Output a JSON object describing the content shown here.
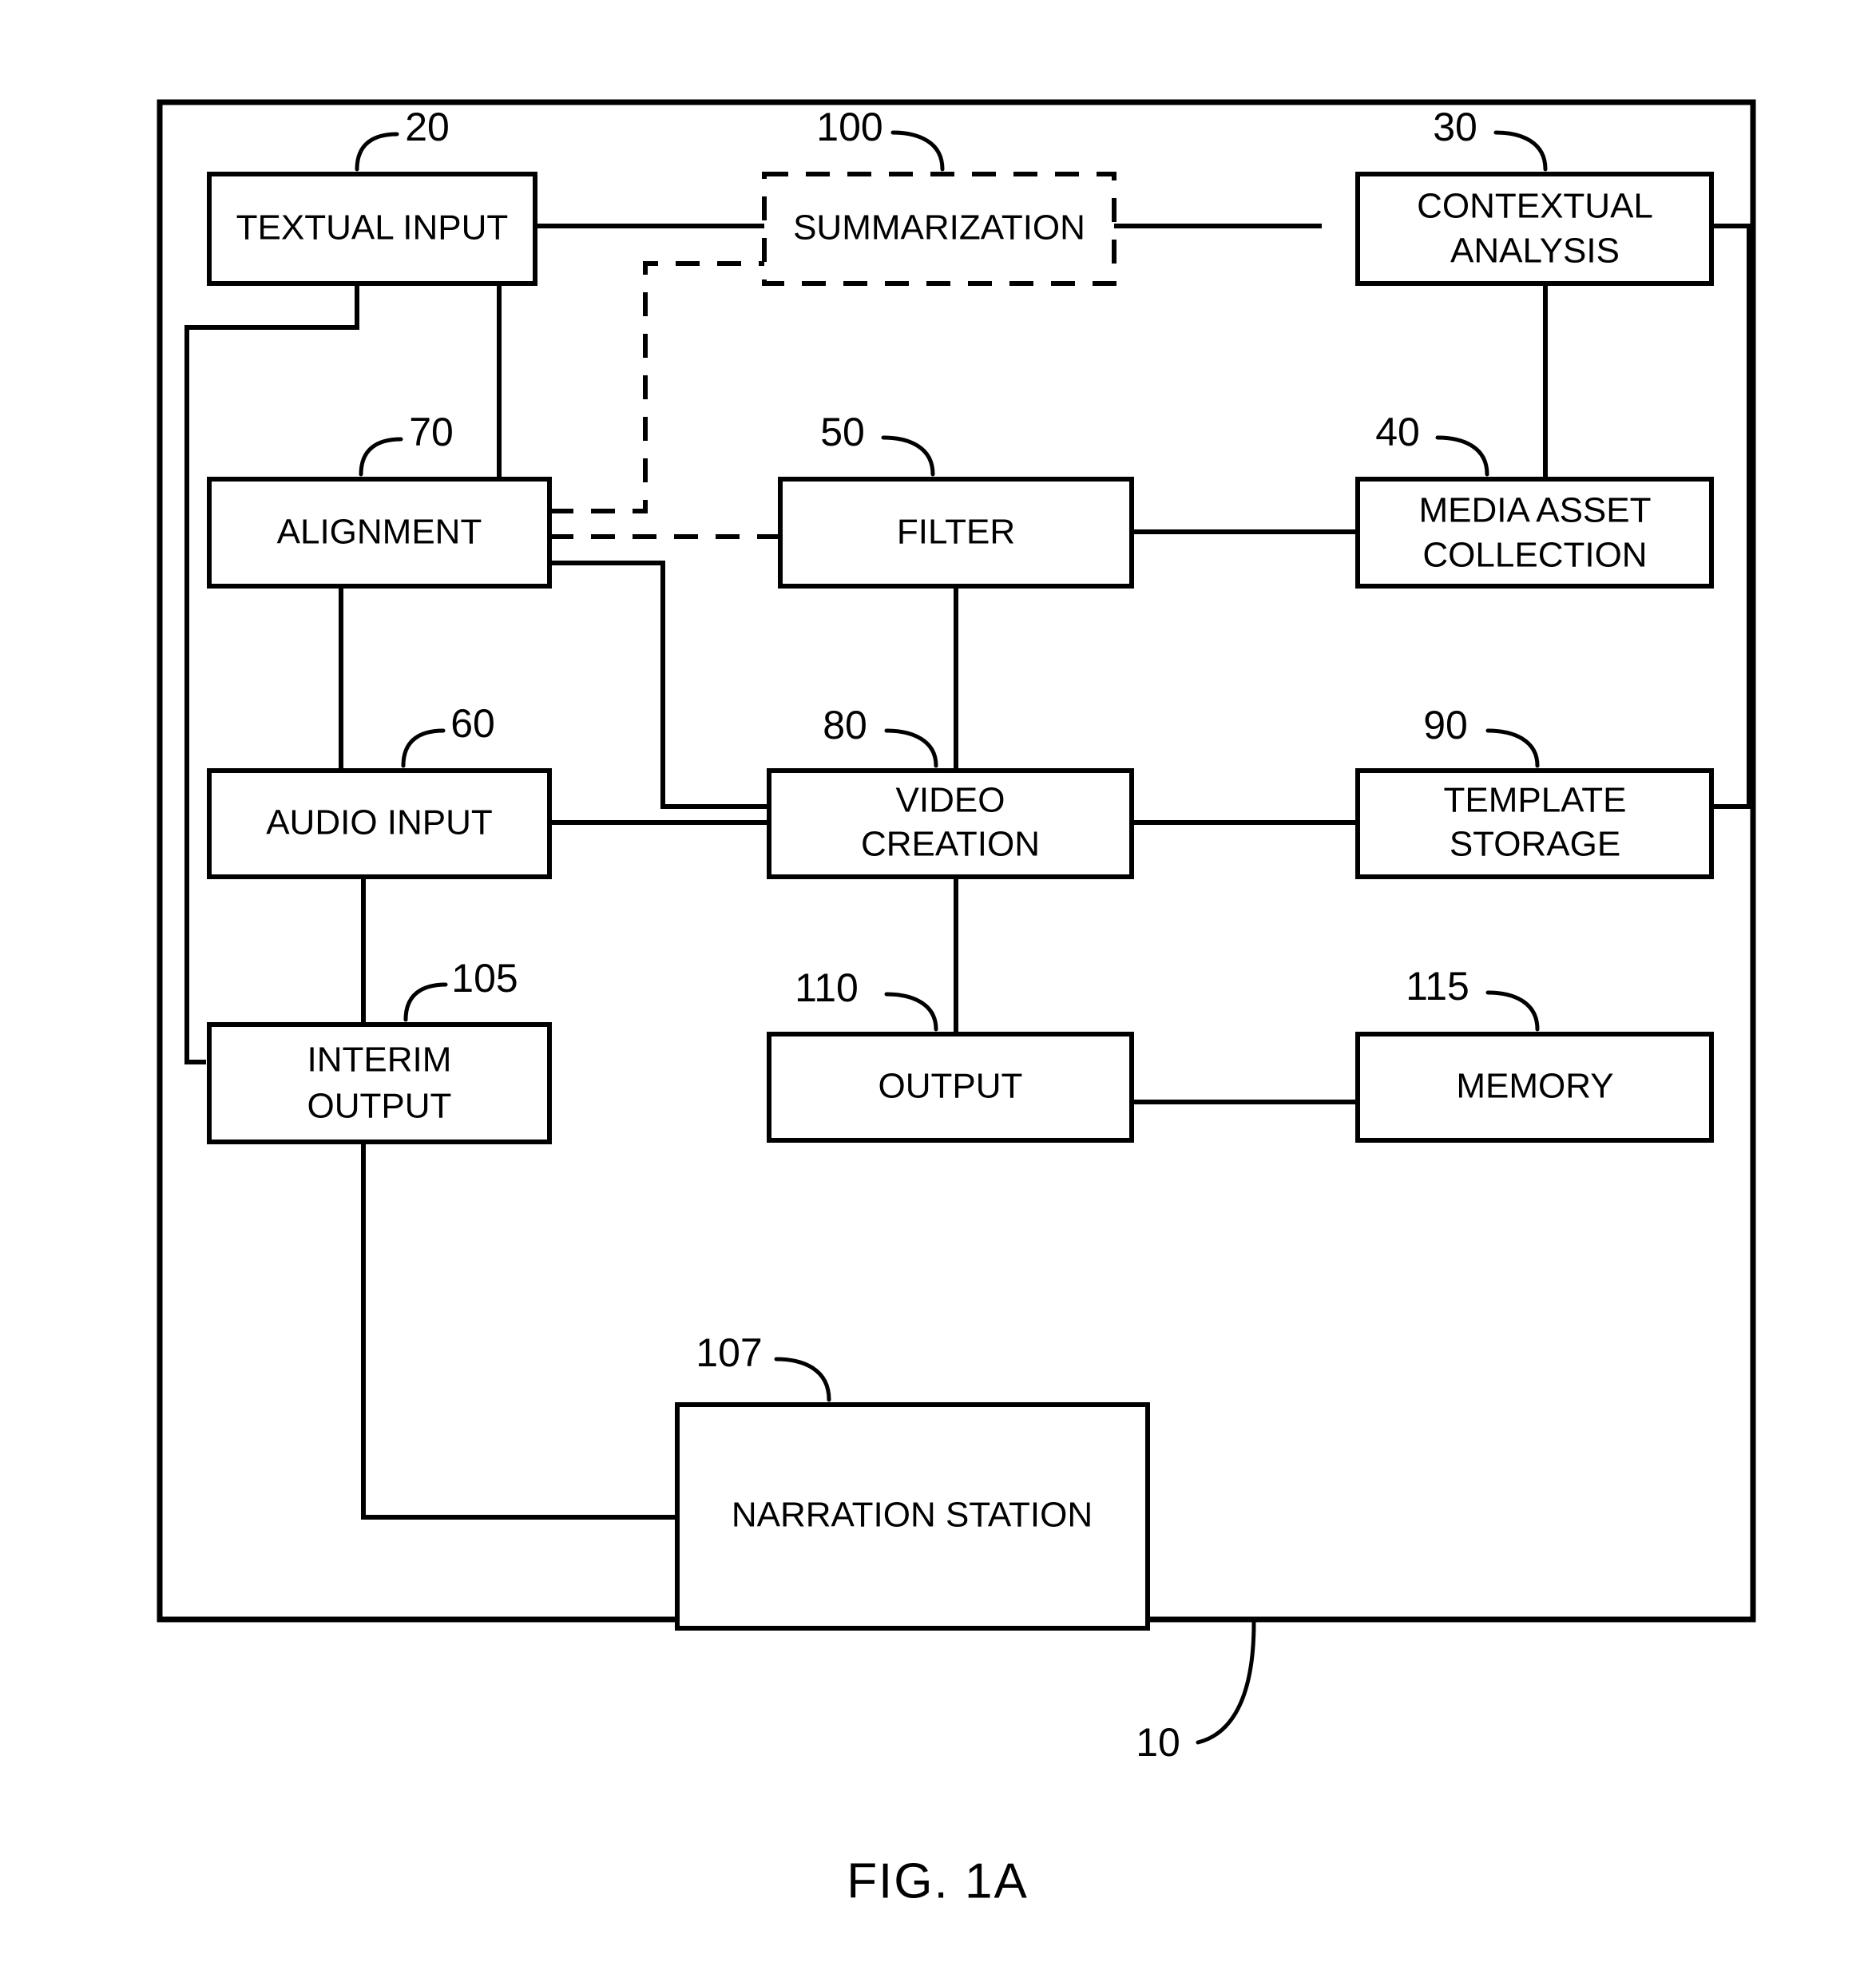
{
  "figure": {
    "caption": "FIG. 1A",
    "system_ref": "10"
  },
  "blocks": [
    {
      "id": "textual-input",
      "label_line1": "TEXTUAL INPUT",
      "label_line2": "",
      "ref": "20",
      "style": "solid"
    },
    {
      "id": "summarization",
      "label_line1": "SUMMARIZATION",
      "label_line2": "",
      "ref": "100",
      "style": "dashed"
    },
    {
      "id": "contextual-analysis",
      "label_line1": "CONTEXTUAL",
      "label_line2": "ANALYSIS",
      "ref": "30",
      "style": "solid"
    },
    {
      "id": "alignment",
      "label_line1": "ALIGNMENT",
      "label_line2": "",
      "ref": "70",
      "style": "solid"
    },
    {
      "id": "filter",
      "label_line1": "FILTER",
      "label_line2": "",
      "ref": "50",
      "style": "solid"
    },
    {
      "id": "media-asset-collection",
      "label_line1": "MEDIA ASSET",
      "label_line2": "COLLECTION",
      "ref": "40",
      "style": "solid"
    },
    {
      "id": "audio-input",
      "label_line1": "AUDIO INPUT",
      "label_line2": "",
      "ref": "60",
      "style": "solid"
    },
    {
      "id": "video-creation",
      "label_line1": "VIDEO",
      "label_line2": "CREATION",
      "ref": "80",
      "style": "solid"
    },
    {
      "id": "template-storage",
      "label_line1": "TEMPLATE",
      "label_line2": "STORAGE",
      "ref": "90",
      "style": "solid"
    },
    {
      "id": "interim-output",
      "label_line1": "INTERIM",
      "label_line2": "OUTPUT",
      "ref": "105",
      "style": "solid"
    },
    {
      "id": "output",
      "label_line1": "OUTPUT",
      "label_line2": "",
      "ref": "110",
      "style": "solid"
    },
    {
      "id": "memory",
      "label_line1": "MEMORY",
      "label_line2": "",
      "ref": "115",
      "style": "solid"
    },
    {
      "id": "narration-station",
      "label_line1": "NARRATION STATION",
      "label_line2": "",
      "ref": "107",
      "style": "solid"
    }
  ],
  "colors": {
    "line": "#000000",
    "background": "#ffffff",
    "text": "#000000"
  }
}
